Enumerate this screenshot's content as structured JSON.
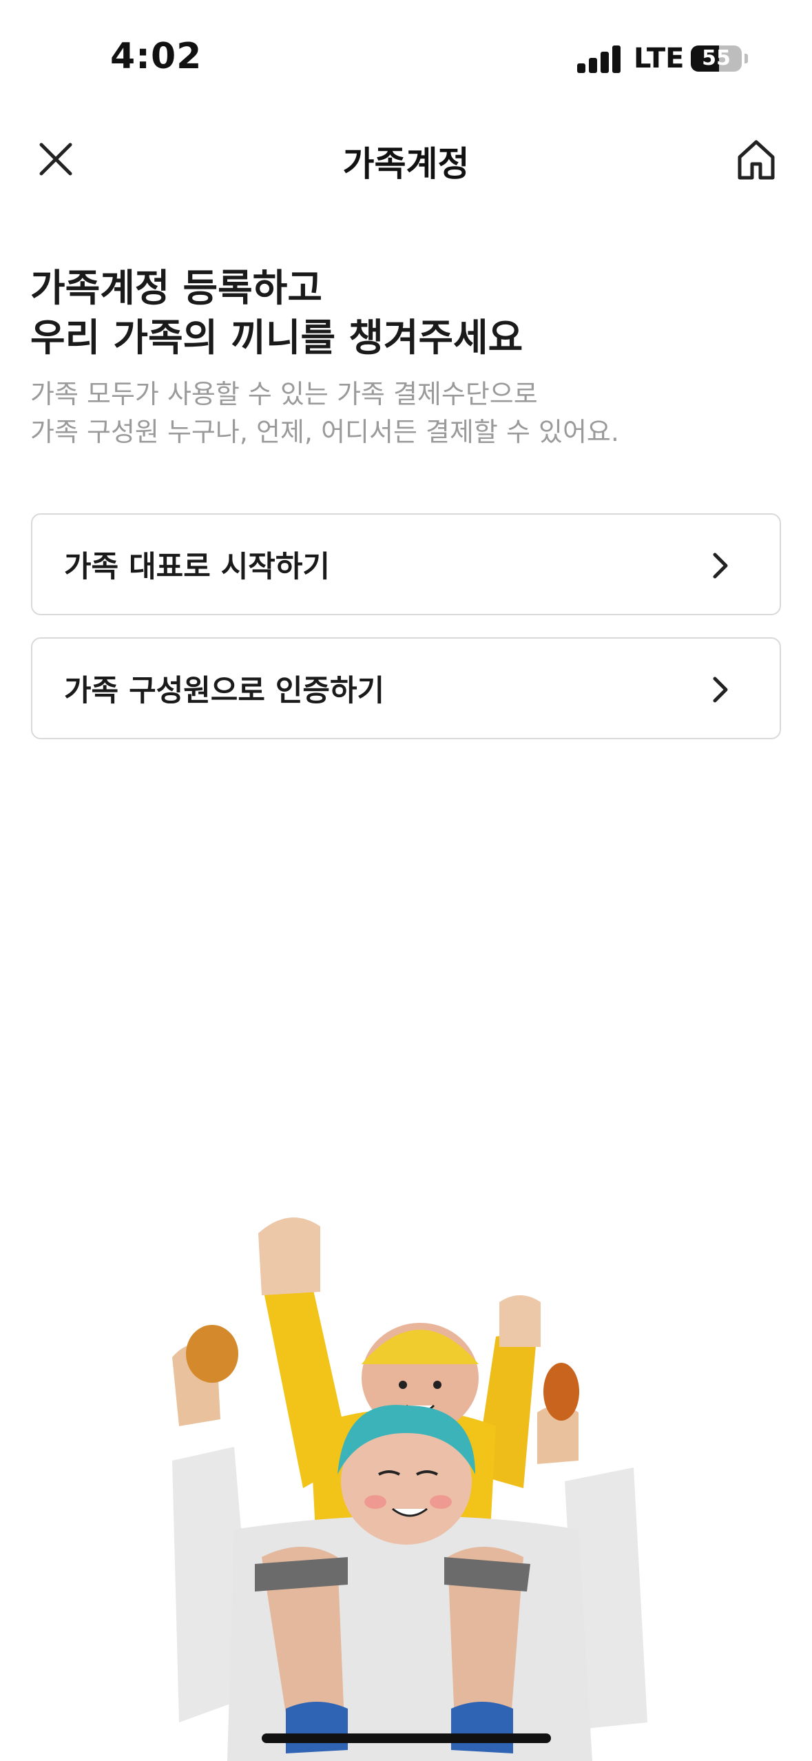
{
  "status_bar": {
    "time": "4:02",
    "network": "LTE",
    "battery_level": "55"
  },
  "nav": {
    "title": "가족계정",
    "close_icon": "close-icon",
    "home_icon": "home-icon"
  },
  "hero": {
    "headline_highlight": "가족계정",
    "headline_rest_line1": " 등록하고",
    "headline_line2": "우리 가족의 끼니를 챙겨주세요",
    "subtext_line1": "가족 모두가 사용할 수 있는 가족 결제수단으로",
    "subtext_line2": "가족 구성원 누구나, 언제, 어디서든 결제할 수 있어요.",
    "highlight_color": "#a6e4e0"
  },
  "options": [
    {
      "label": "가족 대표로 시작하기",
      "icon": "chevron-right-icon"
    },
    {
      "label": "가족 구성원으로 인증하기",
      "icon": "chevron-right-icon"
    }
  ],
  "illustration": {
    "icon": "family-celebration-illustration"
  }
}
